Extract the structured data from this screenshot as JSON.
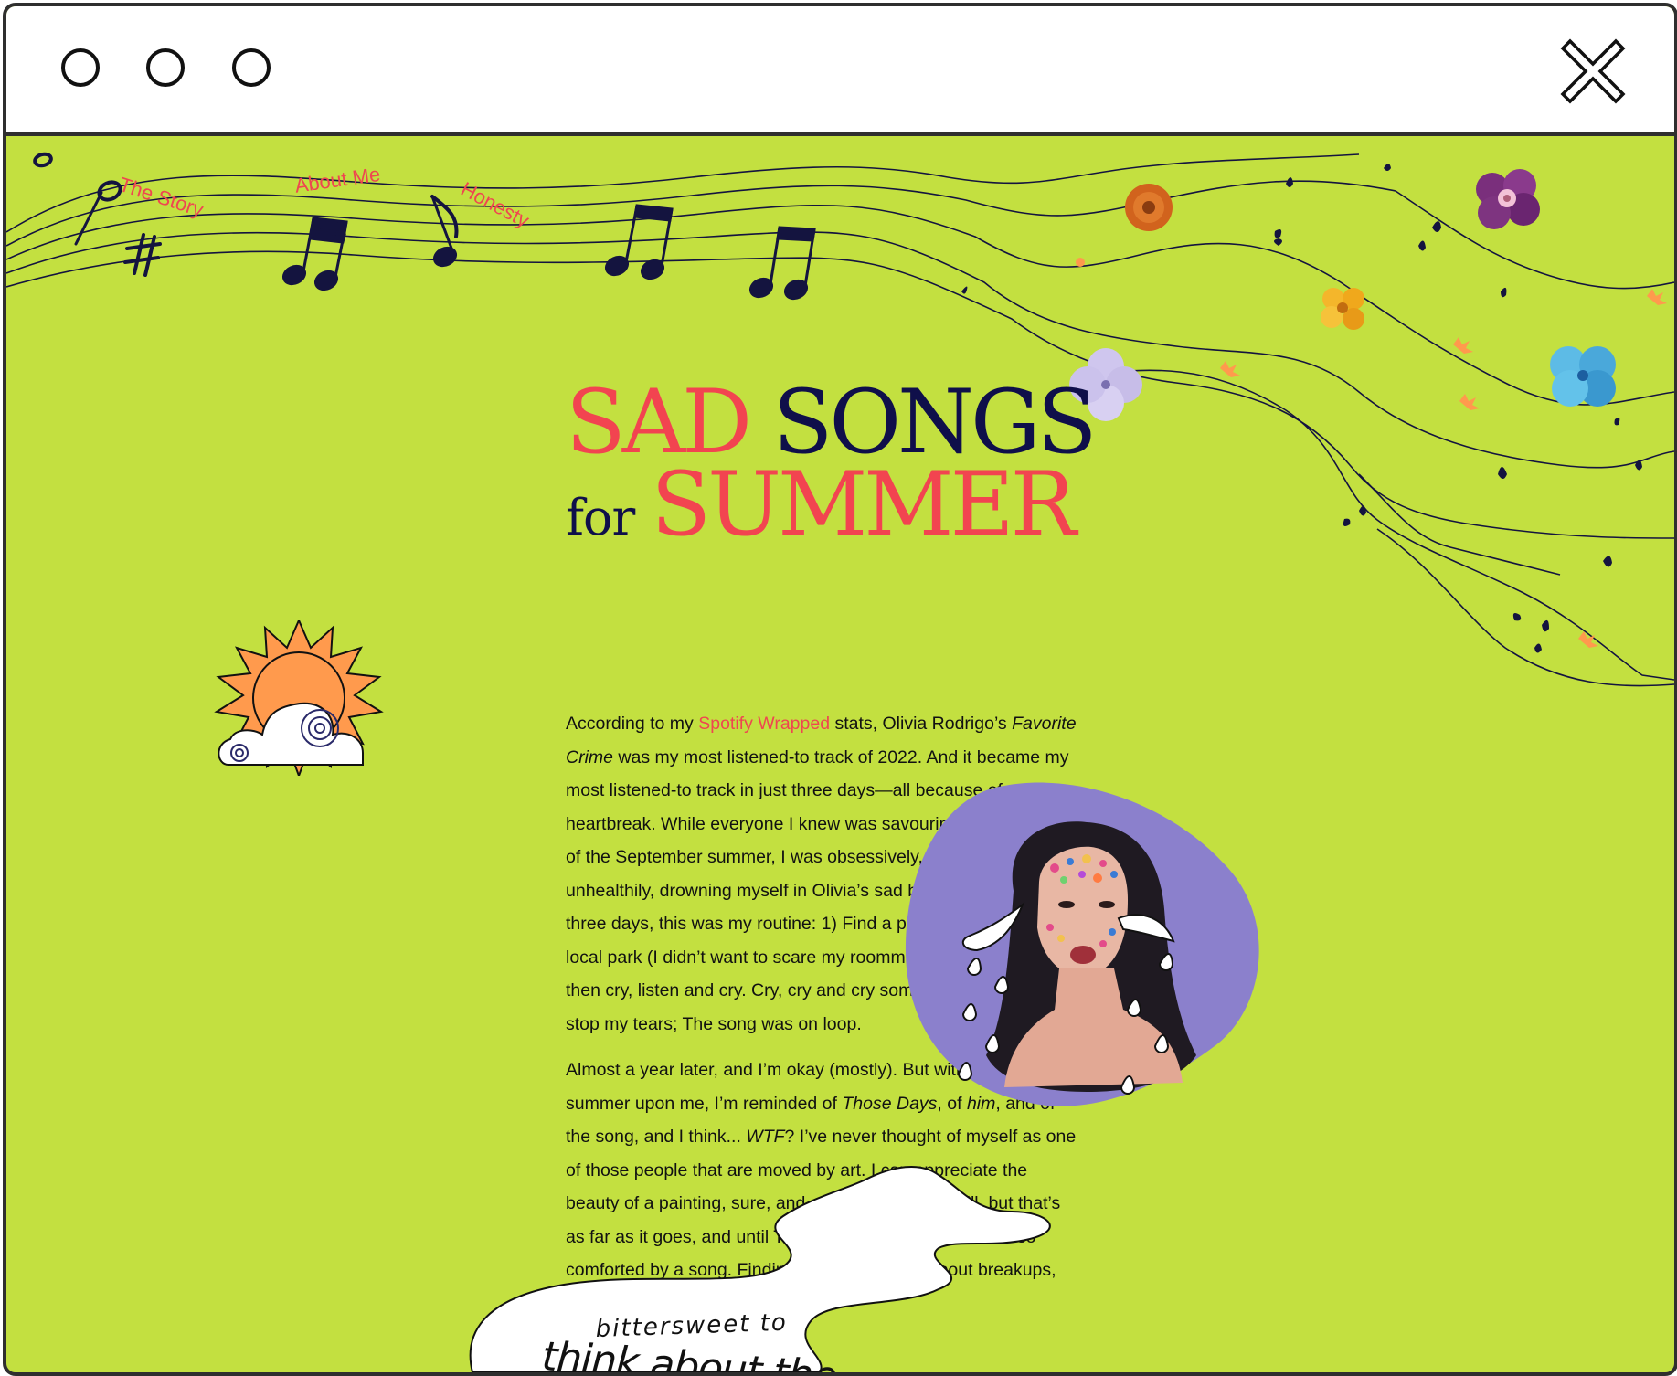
{
  "window": {
    "controls": [
      "window-dot-1",
      "window-dot-2",
      "window-dot-3"
    ],
    "close_icon": "close-x-icon"
  },
  "nav": {
    "items": [
      {
        "label": "The Story"
      },
      {
        "label": "About Me"
      },
      {
        "label": "Honesty"
      }
    ]
  },
  "title": {
    "word1": "SAD",
    "word2": "SONGS",
    "word3": "for",
    "word4": "SUMMER"
  },
  "article": {
    "p1": {
      "intro": "According to my ",
      "link": "Spotify Wrapped",
      "after_link": " stats, Olivia Rodrigo’s ",
      "song": "Favorite Crime",
      "rest": " was my most listened-to track of 2022. And it became my most listened-to track in just three days—all because of a heartbreak. While everyone I knew was savouring the last days of the September summer, I was obsessively, probably unhealthily, drowning myself in Olivia’s sad but hopeful song. For three days, this was my routine: 1) Find a private spot in my local park (I didn’t want to scare my roommates), and 2) listen, then cry, listen and cry. Cry, cry and cry some more. No need to stop my tears; The song was on loop."
    },
    "p2": {
      "a": "Almost a year later, and I’m okay (mostly). But with a new summer upon me, I’m reminded of ",
      "b": "Those Days",
      "c": ", of ",
      "d": "him",
      "e": ", and of the song, and I think... ",
      "f": "WTF",
      "g": "? I’ve never thought of myself as one of those people that are moved by art. I can appreciate the beauty of a painting, sure, and admire its artist’s skill, but that’s as far as it goes, and until Those Days, I had never been so comforted by a song. Finding solace in songs about breakups,"
    }
  },
  "pullquote": {
    "line1": "bittersweet to",
    "line2": "think about the"
  },
  "colors": {
    "background": "#c3e040",
    "accent_red": "#f24450",
    "navy": "#0f0f4a",
    "photo_purple": "#8b80cc",
    "sun_orange": "#ff9a4d"
  }
}
